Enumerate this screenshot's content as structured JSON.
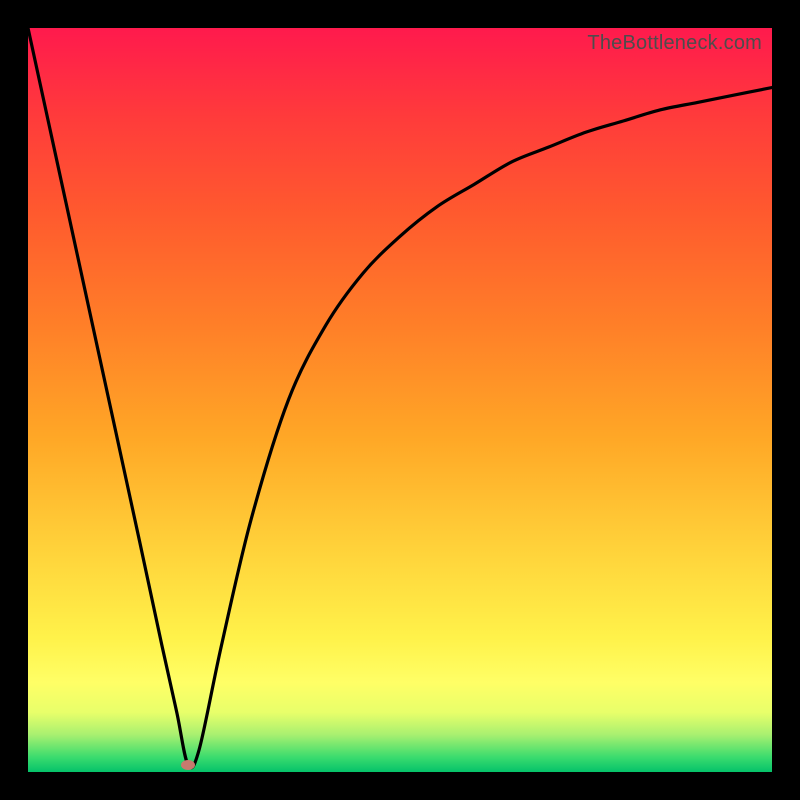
{
  "watermark": "TheBottleneck.com",
  "chart_data": {
    "type": "line",
    "title": "",
    "xlabel": "",
    "ylabel": "",
    "xlim": [
      0,
      100
    ],
    "ylim": [
      0,
      100
    ],
    "grid": false,
    "legend": false,
    "background": "rainbow-vertical-gradient",
    "series": [
      {
        "name": "bottleneck-curve",
        "x": [
          0,
          5,
          10,
          15,
          18,
          20,
          21.5,
          23,
          26,
          30,
          35,
          40,
          45,
          50,
          55,
          60,
          65,
          70,
          75,
          80,
          85,
          90,
          95,
          100
        ],
        "y": [
          100,
          77,
          54,
          31,
          17,
          8,
          1,
          3,
          17,
          34,
          50,
          60,
          67,
          72,
          76,
          79,
          82,
          84,
          86,
          87.5,
          89,
          90,
          91,
          92
        ]
      }
    ],
    "markers": [
      {
        "name": "min-dot",
        "x": 21.5,
        "y": 1,
        "color": "#c77a6e"
      }
    ],
    "gradient_stops": [
      {
        "pos": 0,
        "color": "#ff1a4d"
      },
      {
        "pos": 25,
        "color": "#ff5a2e"
      },
      {
        "pos": 55,
        "color": "#ffa726"
      },
      {
        "pos": 82,
        "color": "#fff24a"
      },
      {
        "pos": 95,
        "color": "#a8f070"
      },
      {
        "pos": 100,
        "color": "#05c26a"
      }
    ]
  }
}
